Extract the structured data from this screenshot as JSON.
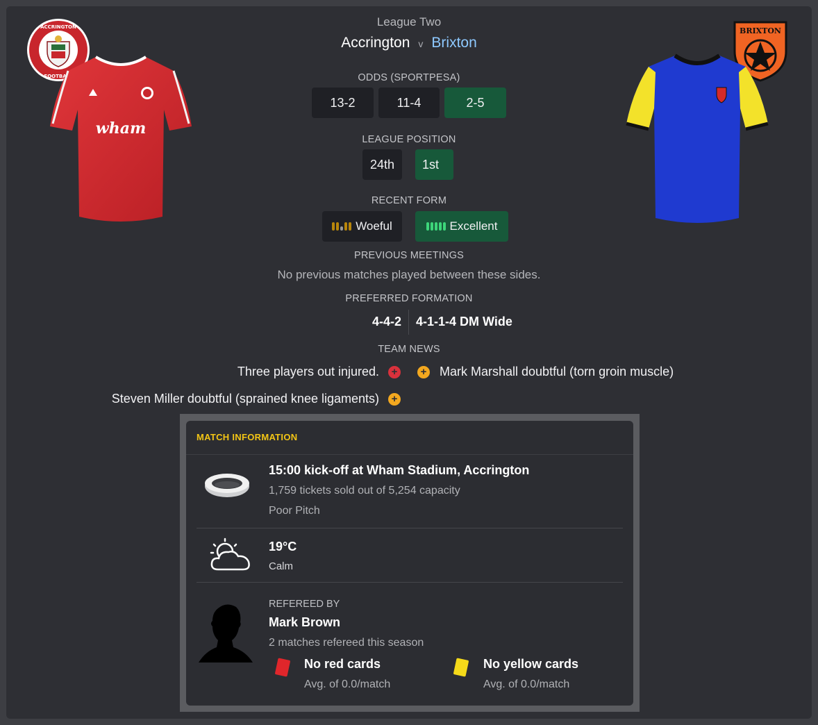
{
  "header": {
    "competition": "League Two",
    "home_team": "Accrington",
    "vs": "v",
    "away_team": "Brixton",
    "home_badge_text": "ACCRINGTON STANLEY FOOTBALL CLUB",
    "away_badge_text": "BRIXTON",
    "home_sponsor": "wham"
  },
  "odds": {
    "label": "ODDS (SPORTPESA)",
    "home": "13-2",
    "draw": "11-4",
    "away": "2-5"
  },
  "league_position": {
    "label": "LEAGUE POSITION",
    "home": "24th",
    "away": "1st"
  },
  "recent_form": {
    "label": "RECENT FORM",
    "home": "Woeful",
    "away": "Excellent"
  },
  "previous_meetings": {
    "label": "PREVIOUS MEETINGS",
    "text": "No previous matches played between these sides."
  },
  "preferred_formation": {
    "label": "PREFERRED FORMATION",
    "home": "4-4-2",
    "away": "4-1-1-4 DM Wide"
  },
  "team_news": {
    "label": "TEAM NEWS",
    "home_items": [
      {
        "text": "Three players out injured.",
        "icon": "injury-icon"
      },
      {
        "text": "Steven Miller doubtful (sprained knee ligaments)",
        "icon": "doubtful-icon"
      }
    ],
    "away_items": [
      {
        "text": "Mark Marshall doubtful (torn groin muscle)",
        "icon": "doubtful-icon"
      }
    ]
  },
  "match_info": {
    "title": "MATCH INFORMATION",
    "venue": {
      "headline": "15:00 kick-off at Wham Stadium, Accrington",
      "tickets": "1,759 tickets sold out of 5,254 capacity",
      "pitch": "Poor Pitch"
    },
    "weather": {
      "temperature": "19°C",
      "wind": "Calm"
    },
    "referee": {
      "label": "REFEREED BY",
      "name": "Mark Brown",
      "matches": "2 matches refereed this season",
      "red_cards": "No red cards",
      "red_avg": "Avg. of 0.0/match",
      "yellow_cards": "No yellow cards",
      "yellow_avg": "Avg. of 0.0/match"
    }
  },
  "colors": {
    "accent_green": "#17593a",
    "away_team_text": "#8ec9ff",
    "match_info_title": "#f3c515",
    "injury": "#d9313c",
    "doubtful": "#f3a81f"
  }
}
